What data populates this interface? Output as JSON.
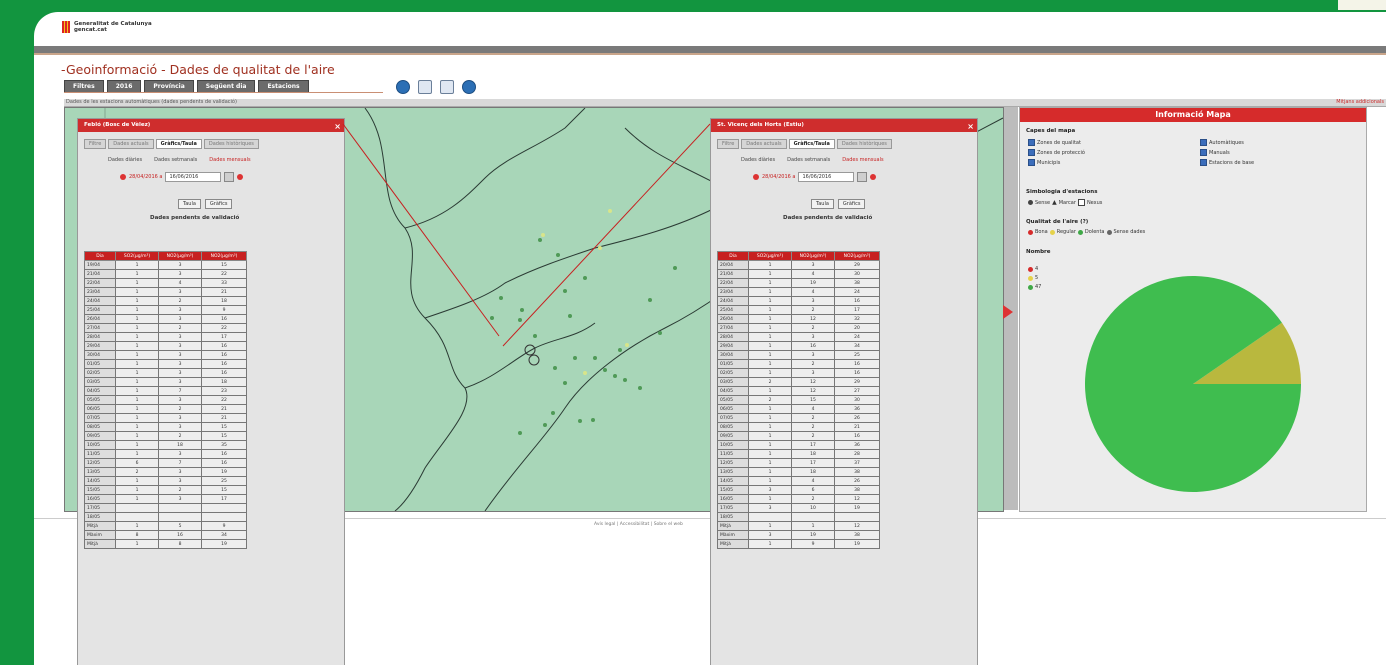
{
  "header": {
    "org_name": "Generalitat de Catalunya",
    "org_site": "gencat.cat",
    "page_title": "-Geoinformació - Dades de qualitat de l'aire"
  },
  "nav": {
    "tabs": [
      "Filtres",
      "2016",
      "Província",
      "Següent dia",
      "Estacions"
    ],
    "icons": [
      "globe-icon",
      "table-icon",
      "window-icon",
      "help-icon"
    ]
  },
  "status": {
    "left": "Dades de les estacions automàtiques (dades pendents de validació)",
    "right": "Mitjans addicionals"
  },
  "footer": {
    "text": "Avís legal | Accessibilitat | Sobre el web"
  },
  "popup1": {
    "title": "Febló (Bosc de Vèlez)",
    "tabs": [
      "Filtre",
      "Dades actuals",
      "Gràfics/Taula",
      "Dades històriques"
    ],
    "active_tab": 2,
    "subtabs": [
      "Dades diàries",
      "Dades setmanals",
      "Dades mensuals"
    ],
    "date_from": "28/04/2016 a",
    "date_to": "16/06/2016",
    "buttons": [
      "Taula",
      "Gràfics"
    ],
    "table_title": "Dades pendents de validació",
    "headers": [
      "Dia",
      "SO2(µg/m³)",
      "NO2(µg/m³)",
      "NO2(µg/m³)"
    ],
    "rows": [
      [
        "19/04",
        "1",
        "3",
        "15"
      ],
      [
        "21/04",
        "1",
        "3",
        "22"
      ],
      [
        "22/04",
        "1",
        "4",
        "33"
      ],
      [
        "23/04",
        "1",
        "3",
        "21"
      ],
      [
        "24/04",
        "1",
        "2",
        "18"
      ],
      [
        "25/04",
        "1",
        "3",
        "9"
      ],
      [
        "26/04",
        "1",
        "3",
        "16"
      ],
      [
        "27/04",
        "1",
        "2",
        "22"
      ],
      [
        "28/04",
        "1",
        "3",
        "17"
      ],
      [
        "29/04",
        "1",
        "3",
        "16"
      ],
      [
        "30/04",
        "1",
        "3",
        "16"
      ],
      [
        "01/05",
        "1",
        "3",
        "16"
      ],
      [
        "02/05",
        "1",
        "3",
        "16"
      ],
      [
        "03/05",
        "1",
        "3",
        "18"
      ],
      [
        "04/05",
        "1",
        "7",
        "23"
      ],
      [
        "05/05",
        "1",
        "3",
        "22"
      ],
      [
        "06/05",
        "1",
        "2",
        "21"
      ],
      [
        "07/05",
        "1",
        "3",
        "21"
      ],
      [
        "08/05",
        "1",
        "3",
        "15"
      ],
      [
        "09/05",
        "1",
        "2",
        "15"
      ],
      [
        "10/05",
        "1",
        "18",
        "35"
      ],
      [
        "11/05",
        "1",
        "3",
        "16"
      ],
      [
        "12/05",
        "6",
        "7",
        "16"
      ],
      [
        "13/05",
        "2",
        "3",
        "19"
      ],
      [
        "14/05",
        "1",
        "3",
        "25"
      ],
      [
        "15/05",
        "1",
        "2",
        "15"
      ],
      [
        "16/05",
        "1",
        "3",
        "17"
      ],
      [
        "17/05",
        "",
        "",
        ""
      ],
      [
        "18/05",
        "",
        "",
        ""
      ],
      [
        "Mitjà",
        "1",
        "5",
        "9"
      ],
      [
        "Màxim",
        "8",
        "16",
        "34"
      ],
      [
        "Mitjà",
        "1",
        "8",
        "19"
      ]
    ]
  },
  "popup2": {
    "title": "St. Vicenç dels Horts (Estiu)",
    "tabs": [
      "Filtre",
      "Dades actuals",
      "Gràfics/Taula",
      "Dades històriques"
    ],
    "active_tab": 2,
    "subtabs": [
      "Dades diàries",
      "Dades setmanals",
      "Dades mensuals"
    ],
    "date_from": "28/04/2016 a",
    "date_to": "16/06/2016",
    "buttons": [
      "Taula",
      "Gràfics"
    ],
    "table_title": "Dades pendents de validació",
    "headers": [
      "Dia",
      "SO2(µg/m³)",
      "NO2(µg/m³)",
      "NO2(µg/m³)"
    ],
    "rows": [
      [
        "20/04",
        "1",
        "3",
        "29"
      ],
      [
        "21/04",
        "1",
        "4",
        "30"
      ],
      [
        "22/04",
        "1",
        "19",
        "38"
      ],
      [
        "23/04",
        "1",
        "4",
        "24"
      ],
      [
        "24/04",
        "1",
        "3",
        "16"
      ],
      [
        "25/04",
        "1",
        "2",
        "17"
      ],
      [
        "26/04",
        "1",
        "12",
        "32"
      ],
      [
        "27/04",
        "1",
        "2",
        "20"
      ],
      [
        "28/04",
        "1",
        "3",
        "24"
      ],
      [
        "29/04",
        "1",
        "16",
        "34"
      ],
      [
        "30/04",
        "1",
        "3",
        "25"
      ],
      [
        "01/05",
        "1",
        "2",
        "16"
      ],
      [
        "02/05",
        "1",
        "3",
        "16"
      ],
      [
        "03/05",
        "2",
        "12",
        "29"
      ],
      [
        "04/05",
        "1",
        "12",
        "27"
      ],
      [
        "05/05",
        "2",
        "15",
        "30"
      ],
      [
        "06/05",
        "1",
        "4",
        "36"
      ],
      [
        "07/05",
        "1",
        "2",
        "26"
      ],
      [
        "08/05",
        "1",
        "2",
        "21"
      ],
      [
        "09/05",
        "1",
        "2",
        "16"
      ],
      [
        "10/05",
        "1",
        "17",
        "36"
      ],
      [
        "11/05",
        "1",
        "18",
        "28"
      ],
      [
        "12/05",
        "1",
        "17",
        "37"
      ],
      [
        "13/05",
        "1",
        "18",
        "38"
      ],
      [
        "14/05",
        "1",
        "4",
        "26"
      ],
      [
        "15/05",
        "3",
        "6",
        "38"
      ],
      [
        "16/05",
        "1",
        "2",
        "12"
      ],
      [
        "17/05",
        "3",
        "10",
        "19"
      ],
      [
        "18/05",
        "",
        "",
        ""
      ],
      [
        "Mitjà",
        "1",
        "1",
        "12"
      ],
      [
        "Màxim",
        "3",
        "19",
        "38"
      ],
      [
        "Mitjà",
        "1",
        "9",
        "19"
      ]
    ]
  },
  "info": {
    "title": "Informació Mapa",
    "layers_title": "Capes del mapa",
    "layers": [
      "Zones de qualitat",
      "Zones de protecció",
      "Municipis",
      "Automàtiques",
      "Manuals",
      "Estacions de base"
    ],
    "symbology_title": "Simbologia d'estacions",
    "symbology": [
      "Sense",
      "Marcar",
      "Nexus"
    ],
    "quality_title": "Qualitat de l'aire (?)",
    "quality": [
      "Bona",
      "Regular",
      "Dolenta",
      "Sense dades"
    ],
    "quality_colors": [
      "#d62b2b",
      "#e5d24a",
      "#3fa847",
      "#666666"
    ],
    "count_title": "Nombre",
    "legend": [
      "4",
      "5",
      "47"
    ],
    "legend_colors": [
      "#d62b2b",
      "#e5d24a",
      "#3fa847"
    ]
  },
  "chart_data": {
    "type": "pie",
    "categories": [
      "4",
      "5",
      "47"
    ],
    "values": [
      0,
      5,
      47
    ],
    "colors": [
      "#d62b2b",
      "#b9b83e",
      "#3fbd4f"
    ]
  }
}
